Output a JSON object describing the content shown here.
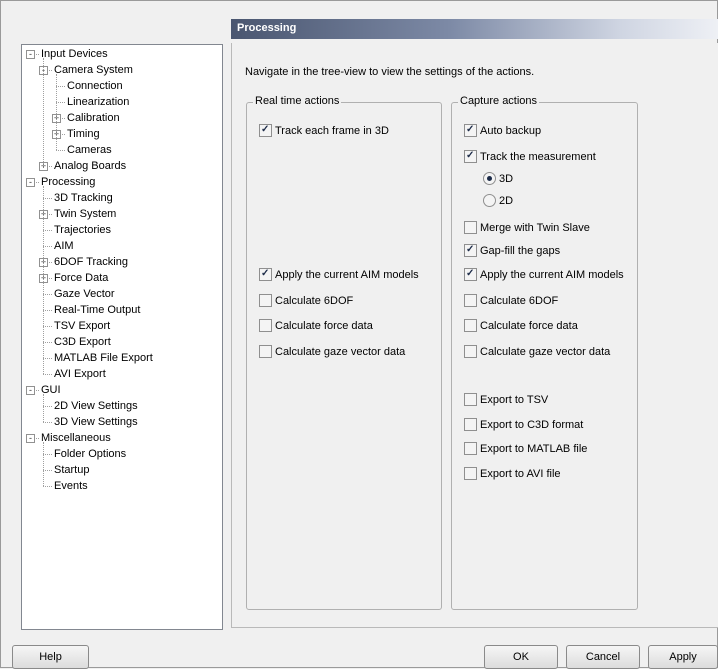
{
  "tree": {
    "items": [
      {
        "label": "Input Devices",
        "exp": "-"
      },
      {
        "label": "Camera System",
        "exp": "-"
      },
      {
        "label": "Connection",
        "exp": ""
      },
      {
        "label": "Linearization",
        "exp": ""
      },
      {
        "label": "Calibration",
        "exp": "+"
      },
      {
        "label": "Timing",
        "exp": "+"
      },
      {
        "label": "Cameras",
        "exp": ""
      },
      {
        "label": "Analog Boards",
        "exp": "+"
      },
      {
        "label": "Processing",
        "exp": "-"
      },
      {
        "label": "3D Tracking",
        "exp": ""
      },
      {
        "label": "Twin System",
        "exp": "+"
      },
      {
        "label": "Trajectories",
        "exp": ""
      },
      {
        "label": "AIM",
        "exp": ""
      },
      {
        "label": "6DOF Tracking",
        "exp": "+"
      },
      {
        "label": "Force Data",
        "exp": "+"
      },
      {
        "label": "Gaze Vector",
        "exp": ""
      },
      {
        "label": "Real-Time Output",
        "exp": ""
      },
      {
        "label": "TSV Export",
        "exp": ""
      },
      {
        "label": "C3D Export",
        "exp": ""
      },
      {
        "label": "MATLAB File Export",
        "exp": ""
      },
      {
        "label": "AVI Export",
        "exp": ""
      },
      {
        "label": "GUI",
        "exp": "-"
      },
      {
        "label": "2D View Settings",
        "exp": ""
      },
      {
        "label": "3D View Settings",
        "exp": ""
      },
      {
        "label": "Miscellaneous",
        "exp": "-"
      },
      {
        "label": "Folder Options",
        "exp": ""
      },
      {
        "label": "Startup",
        "exp": ""
      },
      {
        "label": "Events",
        "exp": ""
      }
    ]
  },
  "panel": {
    "title": "Processing",
    "intro": "Navigate in the tree-view to view the settings of the actions."
  },
  "realtime": {
    "title": "Real time actions",
    "track_3d": {
      "label": "Track each frame in 3D",
      "checked": true
    },
    "apply_aim": {
      "label": "Apply the current AIM models",
      "checked": true
    },
    "calc_6dof": {
      "label": "Calculate 6DOF",
      "checked": false
    },
    "calc_force": {
      "label": "Calculate force data",
      "checked": false
    },
    "calc_gaze": {
      "label": "Calculate gaze vector data",
      "checked": false
    }
  },
  "capture": {
    "title": "Capture actions",
    "auto_backup": {
      "label": "Auto backup",
      "checked": true
    },
    "track_measurement": {
      "label": "Track the measurement",
      "checked": true
    },
    "radio_3d": {
      "label": "3D",
      "checked": true
    },
    "radio_2d": {
      "label": "2D",
      "checked": false
    },
    "merge_twin": {
      "label": "Merge with Twin Slave",
      "checked": false
    },
    "gap_fill": {
      "label": "Gap-fill the gaps",
      "checked": true
    },
    "apply_aim": {
      "label": "Apply the current AIM models",
      "checked": true
    },
    "calc_6dof": {
      "label": "Calculate 6DOF",
      "checked": false
    },
    "calc_force": {
      "label": "Calculate force data",
      "checked": false
    },
    "calc_gaze": {
      "label": "Calculate gaze vector data",
      "checked": false
    },
    "export_tsv": {
      "label": "Export to TSV",
      "checked": false
    },
    "export_c3d": {
      "label": "Export to C3D format",
      "checked": false
    },
    "export_matlab": {
      "label": "Export to MATLAB file",
      "checked": false
    },
    "export_avi": {
      "label": "Export to AVI file",
      "checked": false
    }
  },
  "buttons": {
    "help": "Help",
    "ok": "OK",
    "cancel": "Cancel",
    "apply": "Apply"
  }
}
